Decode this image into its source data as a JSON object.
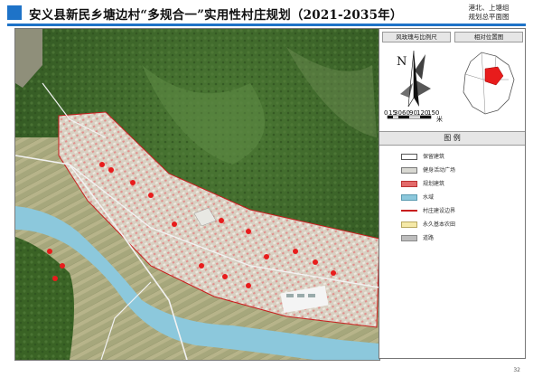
{
  "header": {
    "title": "安义县新民乡塘边村“多规合一”实用性村庄规划（2021-2035年）",
    "corner_line1": "港北、上塘组",
    "corner_line2": "规划总平面图"
  },
  "side_panel": {
    "compass_heading": "风玫瑰与比例尺",
    "location_heading": "相对位置图",
    "north_letter": "N",
    "scale_ticks": [
      "0",
      "15",
      "30",
      "60",
      "90",
      "120",
      "150"
    ],
    "scale_unit": "米",
    "legend_heading": "图  例",
    "legend": [
      {
        "label": "保留建筑",
        "swatch": "retained"
      },
      {
        "label": "健身活动广场",
        "swatch": "plaza"
      },
      {
        "label": "规划建筑",
        "swatch": "planned"
      },
      {
        "label": "水域",
        "swatch": "water"
      },
      {
        "label": "村庄建设边界",
        "swatch": "boundary"
      },
      {
        "label": "永久基本农田",
        "swatch": "farmland"
      },
      {
        "label": "道路",
        "swatch": "road"
      }
    ]
  },
  "colors": {
    "title_blue": "#1e73c8",
    "forest": "#3f6b2c",
    "water": "#8cc8dc",
    "planned_building": "#e36a6a",
    "boundary": "#c81e1e",
    "highlight_red": "#e81c1c"
  },
  "footer": {
    "page_number": "32"
  }
}
